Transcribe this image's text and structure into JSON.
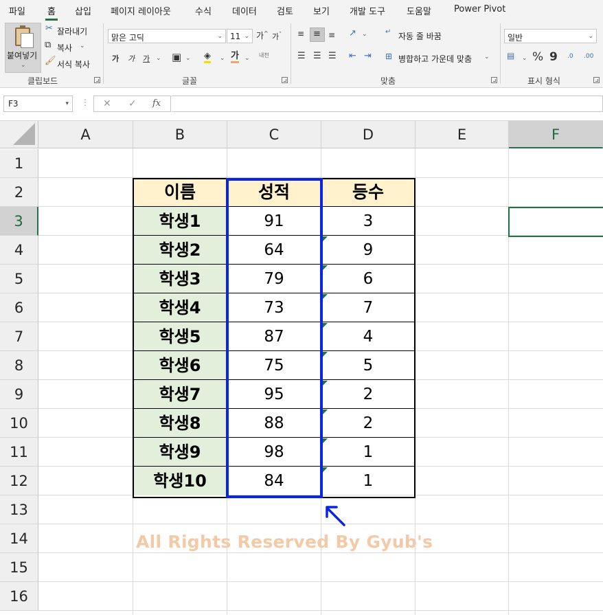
{
  "menu": {
    "tabs": [
      "파일",
      "홈",
      "삽입",
      "페이지 레이아웃",
      "수식",
      "데이터",
      "검토",
      "보기",
      "개발 도구",
      "도움말",
      "Power Pivot"
    ],
    "active": "홈"
  },
  "ribbon": {
    "clipboard": {
      "paste_label": "붙여넣기",
      "cut": "잘라내기",
      "copy": "복사",
      "format_painter": "서식 복사",
      "group_label": "클립보드"
    },
    "font": {
      "font_name": "맑은 고딕",
      "font_size": "11",
      "grow": "가",
      "shrink": "가",
      "bold": "가",
      "italic": "가",
      "underline": "가",
      "font_color_glyph": "가",
      "phonetic": "내천",
      "group_label": "글꼴"
    },
    "alignment": {
      "wrap_text": "자동 줄 바꿈",
      "merge_center": "병합하고 가운데 맞춤",
      "group_label": "맞춤"
    },
    "number": {
      "format": "일반",
      "percent": "%",
      "comma": "9",
      "inc_decimal": ".0",
      "dec_decimal": ".00",
      "group_label": "표시 형식"
    }
  },
  "formula_bar": {
    "name_box": "F3",
    "cancel_icon": "✕",
    "enter_icon": "✓",
    "fx": "fx",
    "value": ""
  },
  "grid": {
    "columns": [
      "A",
      "B",
      "C",
      "D",
      "E",
      "F"
    ],
    "rows": [
      "1",
      "2",
      "3",
      "4",
      "5",
      "6",
      "7",
      "8",
      "9",
      "10",
      "11",
      "12",
      "13",
      "14",
      "15",
      "16"
    ],
    "selected_column": "F",
    "selected_row": "3"
  },
  "table": {
    "headers": [
      "이름",
      "성적",
      "등수"
    ],
    "rows": [
      [
        "학생1",
        "91",
        "3"
      ],
      [
        "학생2",
        "64",
        "9"
      ],
      [
        "학생3",
        "79",
        "6"
      ],
      [
        "학생4",
        "73",
        "7"
      ],
      [
        "학생5",
        "87",
        "4"
      ],
      [
        "학생6",
        "75",
        "5"
      ],
      [
        "학생7",
        "95",
        "2"
      ],
      [
        "학생8",
        "88",
        "2"
      ],
      [
        "학생9",
        "98",
        "1"
      ],
      [
        "학생10",
        "84",
        "1"
      ]
    ]
  },
  "watermark": "All Rights Reserved By Gyub's",
  "colors": {
    "accent": "#217346",
    "header_fill": "#fff2cc",
    "name_fill": "#e2efda",
    "highlight_border": "#0a24e6",
    "watermark": "#f3c9a6"
  }
}
